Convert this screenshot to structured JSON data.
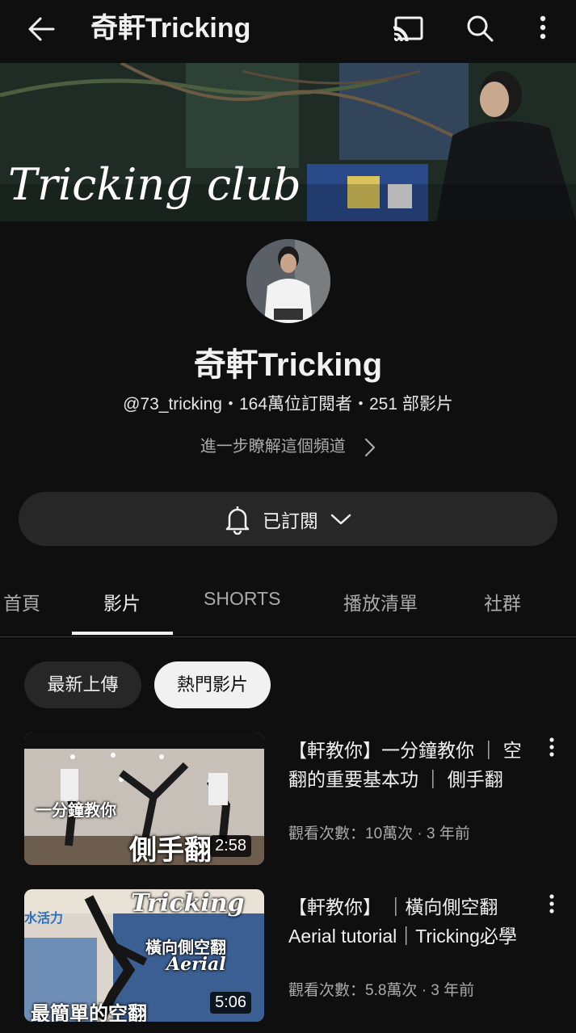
{
  "header": {
    "title": "奇軒Tricking",
    "back_icon": "arrow-left-icon",
    "icons": [
      "cast-icon",
      "search-icon",
      "more-vert-icon"
    ]
  },
  "banner": {
    "text": "Tricking club"
  },
  "channel": {
    "name": "奇軒Tricking",
    "meta": "@73_tricking・164萬位訂閱者・251 部影片",
    "more_info": "進一步瞭解這個頻道"
  },
  "subscribe": {
    "label": "已訂閱"
  },
  "tabs": [
    {
      "label": "首頁"
    },
    {
      "label": "影片"
    },
    {
      "label": "SHORTS"
    },
    {
      "label": "播放清單"
    },
    {
      "label": "社群"
    }
  ],
  "chips": [
    {
      "label": "最新上傳"
    },
    {
      "label": "熱門影片"
    }
  ],
  "videos": [
    {
      "title": "【軒教你】一分鐘教你 ｜ 空翻的重要基本功 ｜ 側手翻",
      "meta": "觀看次數：10萬次 · 3 年前",
      "duration": "2:58",
      "thumb_top": "一分鐘教你",
      "thumb_bottom": "側手翻"
    },
    {
      "title": "【軒教你】 ｜橫向側空翻 Aerial tutorial｜Tricking必學",
      "meta": "觀看次數：5.8萬次 · 3 年前",
      "duration": "5:06",
      "thumb_top": "Tricking",
      "thumb_mid": "橫向側空翻",
      "thumb_mid2": "Aerial",
      "thumb_bottom": "最簡單的空翻",
      "thumb_corner": "水活力"
    }
  ],
  "colors": {
    "background": "#0f0f0f",
    "surface": "#272727",
    "text": "#f1f1f1",
    "muted": "#aaaaaa"
  }
}
